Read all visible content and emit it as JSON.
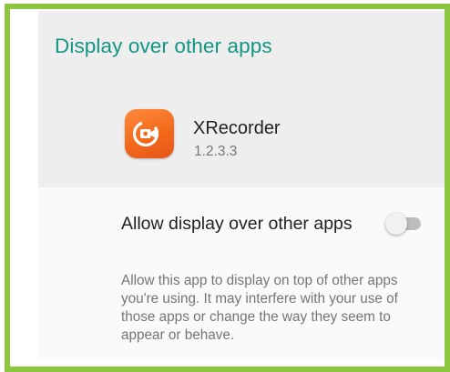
{
  "header": {
    "title": "Display over other apps"
  },
  "app": {
    "name": "XRecorder",
    "version": "1.2.3.3",
    "icon": "xrecorder-app-icon",
    "icon_color": "#F26A1B"
  },
  "setting": {
    "toggle_label": "Allow display over other apps",
    "toggle_state": "off",
    "description": "Allow this app to display on top of other apps you're using. It may interfere with your use of those apps or change the way they seem to appear or behave."
  },
  "colors": {
    "accent": "#139583",
    "frame_border": "#8CC63F"
  }
}
